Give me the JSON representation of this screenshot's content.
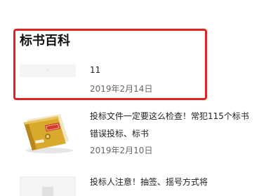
{
  "section": {
    "title": "标书百科"
  },
  "articles": [
    {
      "title": "11",
      "date": "2019年2月14日",
      "thumbnail": "blank-image-placeholder"
    },
    {
      "title": "投标文件一定要这么检查！常犯115个标书错误投标、标书",
      "date": "2019年2月10日",
      "thumbnail": "yellow-binder-folder-illustration"
    },
    {
      "title": "投标人注意！抽签、摇号方式将",
      "date": "",
      "thumbnail": "document-placeholder-icon"
    }
  ],
  "colors": {
    "highlight_border": "#e02424",
    "binder": "#d9a92e",
    "stamp": "#d63a2b"
  }
}
